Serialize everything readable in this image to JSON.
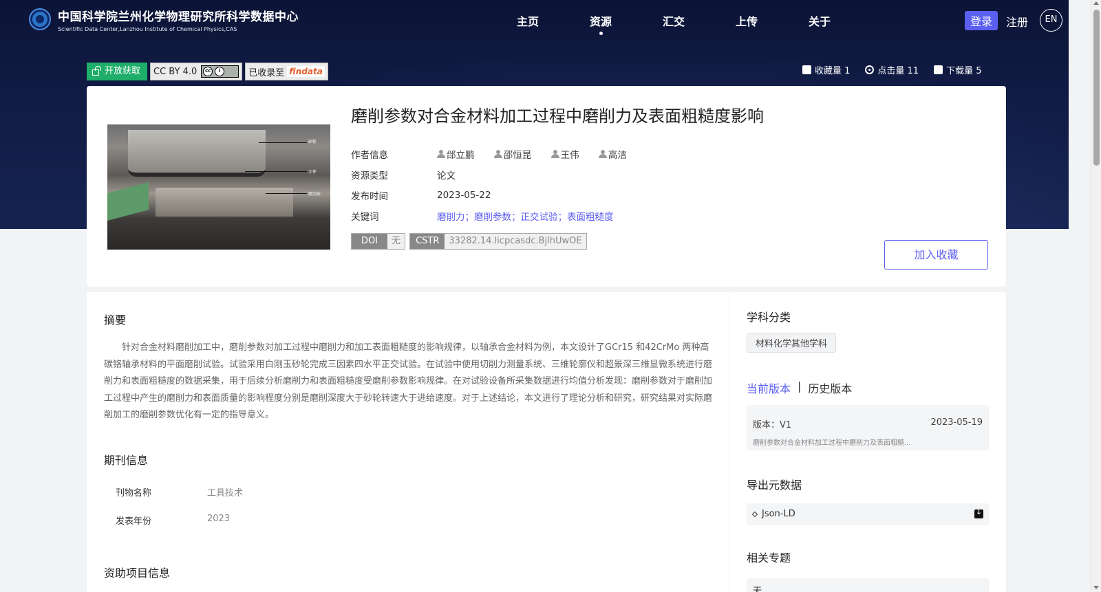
{
  "header": {
    "org_cn": "中国科学院兰州化学物理研究所科学数据中心",
    "org_en": "Scientific Data Center,Lanzhou Institute of Chemical Physics,CAS",
    "nav": [
      "主页",
      "资源",
      "汇交",
      "上传",
      "关于"
    ],
    "active_nav": "资源",
    "login": "登录",
    "register": "注册",
    "lang": "EN"
  },
  "badges": {
    "open_access": "开放获取",
    "license": "CC BY 4.0",
    "indexed": "已收录至",
    "indexed_logo": "findata"
  },
  "stats": {
    "favorites": "收藏量 1",
    "views": "点击量 11",
    "downloads": "下载量 5"
  },
  "resource": {
    "title": "磨削参数对合金材料加工过程中磨削力及表面粗糙度影响",
    "image_labels": [
      "砂轮",
      "工件",
      "测力仪"
    ],
    "labels": {
      "authors": "作者信息",
      "type": "资源类型",
      "date": "发布时间",
      "keywords": "关键词"
    },
    "authors": [
      "邰立鹏",
      "邵恒昆",
      "王伟",
      "高洁"
    ],
    "type": "论文",
    "date": "2023-05-22",
    "keywords": "磨削力；磨削参数；正交试验；表面粗糙度",
    "doi_key": "DOI",
    "doi_val": "无",
    "cstr_key": "CSTR",
    "cstr_val": "33282.14.licpcasdc.BjlhUwOE",
    "favorite_button": "加入收藏"
  },
  "abstract": {
    "title": "摘要",
    "text": "针对合金材料磨削加工中，磨削参数对加工过程中磨削力和加工表面粗糙度的影响规律，以轴承合金材料为例，本文设计了GCr15 和42CrMo 两种高碳铬轴承材料的平面磨削试验。试验采用白刚玉砂轮完成三因素四水平正交试验。在试验中使用切削力测量系统、三维轮廓仪和超景深三维显微系统进行磨削力和表面粗糙度的数据采集，用于后续分析磨削力和表面粗糙度受磨削参数影响规律。在对试验设备所采集数据进行均值分析发现：磨削参数对于磨削加工过程中产生的磨削力和表面质量的影响程度分别是磨削深度大于砂轮转速大于进给速度。对于上述结论，本文进行了理论分析和研究，研究结果对实际磨削加工的磨削参数优化有一定的指导意义。"
  },
  "journal": {
    "title": "期刊信息",
    "name_label": "刊物名称",
    "name": "工具技术",
    "year_label": "发表年份",
    "year": "2023"
  },
  "funding": {
    "title": "资助项目信息"
  },
  "sidebar": {
    "subject_title": "学科分类",
    "subject": "材料化学其他学科",
    "current_version": "当前版本",
    "separator": "|",
    "history_version": "历史版本",
    "version_label": "版本：V1",
    "version_date": "2023-05-19",
    "version_desc": "磨削参数对合金材料加工过程中磨削力及表面粗糙...",
    "export_title": "导出元数据",
    "export_format": "Json-LD",
    "topics_title": "相关专题",
    "topics_value": "无"
  }
}
